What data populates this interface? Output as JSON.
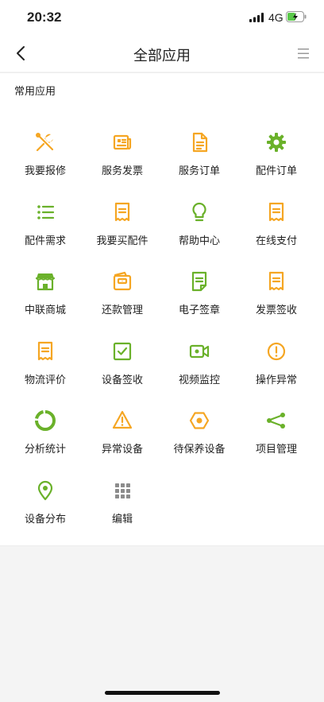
{
  "status_bar": {
    "time": "20:32",
    "network": "4G"
  },
  "nav": {
    "title": "全部应用",
    "back_icon": "chevron-left-icon",
    "menu_icon": "hamburger-menu-icon"
  },
  "section": {
    "title": "常用应用"
  },
  "colors": {
    "green": "#6ab12a",
    "orange": "#f5a623",
    "text": "#222222",
    "gray_icon": "#8c8c8c"
  },
  "apps": [
    {
      "label": "我要报修",
      "icon": "wrench-screwdriver-icon",
      "color": "#f5a623"
    },
    {
      "label": "服务发票",
      "icon": "newspaper-icon",
      "color": "#f5a623"
    },
    {
      "label": "服务订单",
      "icon": "document-icon",
      "color": "#f5a623"
    },
    {
      "label": "配件订单",
      "icon": "gear-icon",
      "color": "#6ab12a"
    },
    {
      "label": "配件需求",
      "icon": "list-icon",
      "color": "#6ab12a"
    },
    {
      "label": "我要买配件",
      "icon": "receipt-icon",
      "color": "#f5a623"
    },
    {
      "label": "帮助中心",
      "icon": "lightbulb-icon",
      "color": "#6ab12a"
    },
    {
      "label": "在线支付",
      "icon": "receipt-icon",
      "color": "#f5a623"
    },
    {
      "label": "中联商城",
      "icon": "store-icon",
      "color": "#6ab12a"
    },
    {
      "label": "还款管理",
      "icon": "wallet-icon",
      "color": "#f5a623"
    },
    {
      "label": "电子签章",
      "icon": "signed-document-icon",
      "color": "#6ab12a"
    },
    {
      "label": "发票签收",
      "icon": "receipt-icon",
      "color": "#f5a623"
    },
    {
      "label": "物流评价",
      "icon": "receipt-icon",
      "color": "#f5a623"
    },
    {
      "label": "设备签收",
      "icon": "checkbox-icon",
      "color": "#6ab12a"
    },
    {
      "label": "视频监控",
      "icon": "video-camera-icon",
      "color": "#6ab12a"
    },
    {
      "label": "操作异常",
      "icon": "alert-circle-icon",
      "color": "#f5a623"
    },
    {
      "label": "分析统计",
      "icon": "donut-chart-icon",
      "color": "#6ab12a"
    },
    {
      "label": "异常设备",
      "icon": "warning-triangle-icon",
      "color": "#f5a623"
    },
    {
      "label": "待保养设备",
      "icon": "hexagon-nut-icon",
      "color": "#f5a623"
    },
    {
      "label": "项目管理",
      "icon": "share-nodes-icon",
      "color": "#6ab12a"
    },
    {
      "label": "设备分布",
      "icon": "location-pin-icon",
      "color": "#6ab12a"
    },
    {
      "label": "编辑",
      "icon": "grid-dots-icon",
      "color": "#8c8c8c"
    }
  ]
}
